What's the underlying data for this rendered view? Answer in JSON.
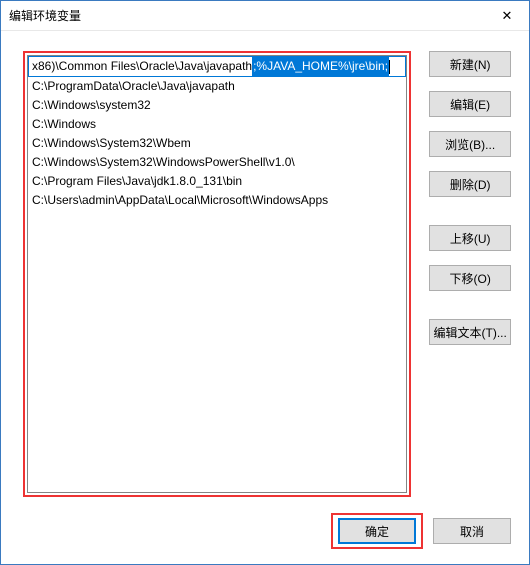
{
  "window": {
    "title": "编辑环境变量"
  },
  "list": {
    "items": [
      {
        "prefix": "x86)\\Common Files\\Oracle\\Java\\javapath",
        "selected": ";%JAVA_HOME%\\jre\\bin;"
      },
      {
        "text": "C:\\ProgramData\\Oracle\\Java\\javapath"
      },
      {
        "text": "C:\\Windows\\system32"
      },
      {
        "text": "C:\\Windows"
      },
      {
        "text": "C:\\Windows\\System32\\Wbem"
      },
      {
        "text": "C:\\Windows\\System32\\WindowsPowerShell\\v1.0\\"
      },
      {
        "text": "C:\\Program Files\\Java\\jdk1.8.0_131\\bin"
      },
      {
        "text": "C:\\Users\\admin\\AppData\\Local\\Microsoft\\WindowsApps"
      }
    ]
  },
  "buttons": {
    "new": "新建(N)",
    "edit": "编辑(E)",
    "browse": "浏览(B)...",
    "delete": "删除(D)",
    "moveup": "上移(U)",
    "movedown": "下移(O)",
    "edittext": "编辑文本(T)...",
    "ok": "确定",
    "cancel": "取消"
  }
}
